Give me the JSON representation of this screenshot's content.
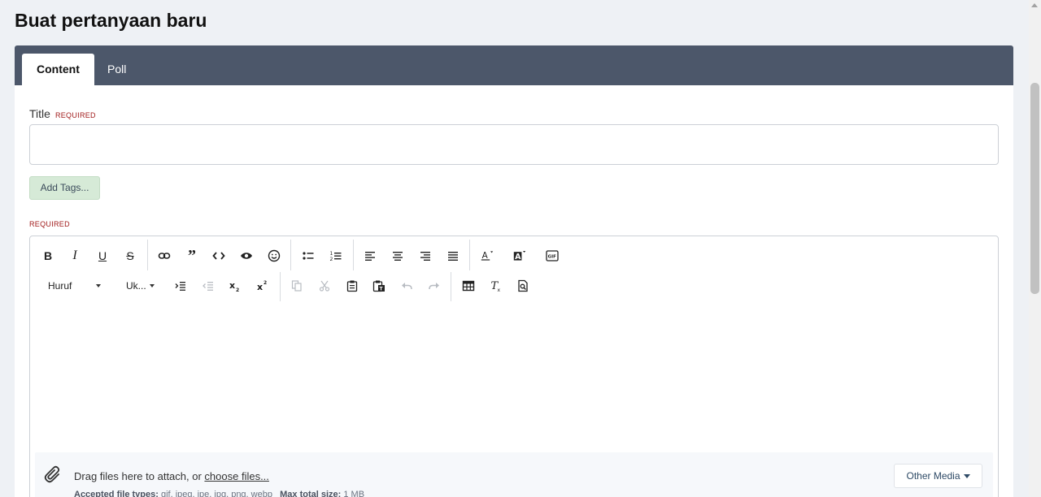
{
  "page": {
    "title": "Buat pertanyaan baru"
  },
  "tabs": [
    {
      "label": "Content",
      "active": true
    },
    {
      "label": "Poll",
      "active": false
    }
  ],
  "form": {
    "title_label": "Title",
    "required_label": "REQUIRED",
    "title_value": "",
    "title_placeholder": "",
    "add_tags_label": "Add Tags...",
    "editor_required_label": "REQUIRED"
  },
  "toolbar": {
    "row1": [
      "bold-icon",
      "italic-icon",
      "underline-icon",
      "strikethrough-icon",
      "link-icon",
      "blockquote-icon",
      "code-icon",
      "spoiler-eye-icon",
      "emoji-icon",
      "bullet-list-icon",
      "numbered-list-icon",
      "align-left-icon",
      "align-center-icon",
      "align-right-icon",
      "justify-icon",
      "text-color-icon",
      "background-color-icon",
      "gif-icon"
    ],
    "font_label": "Huruf",
    "size_label": "Uk...",
    "row2": [
      "indent-icon",
      "outdent-icon",
      "subscript-icon",
      "superscript-icon",
      "copy-icon",
      "cut-icon",
      "paste-icon",
      "paste-text-icon",
      "undo-icon",
      "redo-icon",
      "table-icon",
      "clear-format-icon",
      "preview-icon"
    ]
  },
  "attach": {
    "drag_text": "Drag files here to attach, or ",
    "choose_link": "choose files...",
    "accepted_label": "Accepted file types:",
    "accepted_types": " gif, jpeg, jpe, jpg, png, webp",
    "max_label": "Max total size:",
    "max_value": " 1 MB",
    "other_media_label": "Other Media"
  },
  "colors": {
    "tabbar": "#4c576a",
    "required": "#a11b1b",
    "tags_button": "#d6ead7"
  }
}
